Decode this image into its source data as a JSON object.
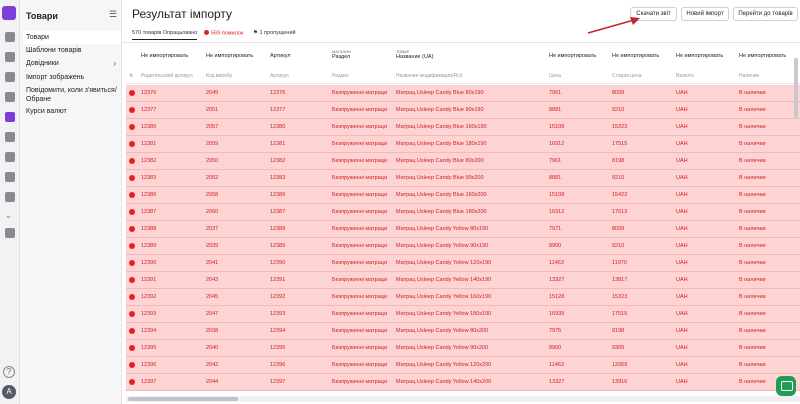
{
  "sidebar": {
    "title": "Товари",
    "items": [
      {
        "label": "Товари"
      },
      {
        "label": "Шаблони товарів"
      },
      {
        "label": "Довідники"
      },
      {
        "label": "Імпорт зображень"
      },
      {
        "label": "Повідомити, коли з'явиться/ Обране"
      },
      {
        "label": "Курси валют"
      }
    ]
  },
  "header": {
    "title": "Результат імпорту",
    "buttons": {
      "download_report": "Скачати звіт",
      "new_import": "Новий імпорт",
      "go_to_products": "Перейти до товарів"
    }
  },
  "tabs": {
    "processed": "570 товарів Опрацьовано",
    "errors": "569 помилок",
    "skipped": "1 пропущений"
  },
  "table": {
    "columns": [
      {
        "top": "Не импортировать",
        "group": "",
        "sub": "Родительский артикул"
      },
      {
        "top": "Не импортировать",
        "group": "",
        "sub": "Код виробу"
      },
      {
        "top": "Артикул",
        "group": "",
        "sub": "Артикул"
      },
      {
        "top": "Раздел",
        "group": "МАГАЗИН",
        "sub": "Раздел"
      },
      {
        "top": "Название (UA)",
        "group": "ТОВАР",
        "sub": "Название модификации(RU)"
      },
      {
        "top": "Не импортировать",
        "group": "",
        "sub": "Цена"
      },
      {
        "top": "Не импортировать",
        "group": "",
        "sub": "Старая цена"
      },
      {
        "top": "Не импортировать",
        "group": "",
        "sub": "Валюта"
      },
      {
        "top": "Не импортировать",
        "group": "",
        "sub": "Наличие"
      }
    ],
    "rows": [
      [
        "12376",
        "2049",
        "12376",
        "Безпружинні матраци",
        "Матрац Usleep Candy Blue 80x190",
        "7961",
        "8099",
        "UAH",
        "В наличии"
      ],
      [
        "12377",
        "2051",
        "12377",
        "Безпружинні матраци",
        "Матрац Usleep Candy Blue 90x190",
        "8881",
        "9210",
        "UAH",
        "В наличии"
      ],
      [
        "12380",
        "2057",
        "12380",
        "Безпружинні матраци",
        "Матрац Usleep Candy Blue 160x190",
        "15108",
        "15323",
        "UAH",
        "В наличии"
      ],
      [
        "12381",
        "2059",
        "12381",
        "Безпружинні матраци",
        "Матрац Usleep Candy Blue 180x190",
        "16912",
        "17515",
        "UAH",
        "В наличии"
      ],
      [
        "12382",
        "2050",
        "12382",
        "Безпружинні матраци",
        "Матрац Usleep Candy Blue 80x200",
        "7961",
        "8198",
        "UAH",
        "В наличии"
      ],
      [
        "12383",
        "2052",
        "12383",
        "Безпружинні матраци",
        "Матрац Usleep Candy Blue 90x200",
        "8881",
        "9210",
        "UAH",
        "В наличии"
      ],
      [
        "12386",
        "2058",
        "12386",
        "Безпружинні матраци",
        "Матрац Usleep Candy Blue 160x200",
        "15108",
        "15422",
        "UAH",
        "В наличии"
      ],
      [
        "12387",
        "2060",
        "12387",
        "Безпружинні матраци",
        "Матрац Usleep Candy Blue 180x200",
        "16912",
        "17613",
        "UAH",
        "В наличии"
      ],
      [
        "12388",
        "2037",
        "12388",
        "Безпружинні матраци",
        "Матрац Usleep Candy Yellow 80x190",
        "7971",
        "8099",
        "UAH",
        "В наличии"
      ],
      [
        "12389",
        "2039",
        "12389",
        "Безпружинні матраци",
        "Матрац Usleep Candy Yellow 90x190",
        "8900",
        "9210",
        "UAH",
        "В наличии"
      ],
      [
        "12390",
        "2041",
        "12390",
        "Безпружинні матраци",
        "Матрац Usleep Candy Yellow 120x190",
        "11463",
        "11970",
        "UAH",
        "В наличии"
      ],
      [
        "12391",
        "2043",
        "12391",
        "Безпружинні матраци",
        "Матрац Usleep Candy Yellow 140x190",
        "13327",
        "13817",
        "UAH",
        "В наличии"
      ],
      [
        "12392",
        "2045",
        "12392",
        "Безпружинні матраци",
        "Матрац Usleep Candy Yellow 160x190",
        "15128",
        "15323",
        "UAH",
        "В наличии"
      ],
      [
        "12393",
        "2047",
        "12393",
        "Безпружинні матраци",
        "Матрац Usleep Candy Yellow 180x190",
        "16935",
        "17515",
        "UAH",
        "В наличии"
      ],
      [
        "12394",
        "2038",
        "12394",
        "Безпружинні матраци",
        "Матрац Usleep Candy Yellow 80x200",
        "7975",
        "8198",
        "UAH",
        "В наличии"
      ],
      [
        "12395",
        "2040",
        "12395",
        "Безпружинні матраци",
        "Матрац Usleep Candy Yellow 90x200",
        "8900",
        "9309",
        "UAH",
        "В наличии"
      ],
      [
        "12396",
        "2042",
        "12396",
        "Безпружинні матраци",
        "Матрац Usleep Candy Yellow 120x200",
        "11463",
        "12069",
        "UAH",
        "В наличии"
      ],
      [
        "12397",
        "2044",
        "12397",
        "Безпружинні матраци",
        "Матрац Usleep Candy Yellow 140x200",
        "13327",
        "13916",
        "UAH",
        "В наличии"
      ]
    ]
  },
  "avatar": {
    "letter": "A"
  },
  "colors": {
    "accent": "#7b3fd8",
    "error": "#e02424",
    "error_row": "#fdd3d3",
    "chat": "#1f9d55"
  },
  "icons": [
    "logo-icon",
    "home-icon",
    "cart-icon",
    "catalog-icon",
    "user-icon",
    "tag-icon",
    "chart-icon",
    "percent-icon",
    "megaphone-icon",
    "store-icon",
    "puzzle-icon",
    "gear-icon",
    "help-icon",
    "chat-icon"
  ]
}
